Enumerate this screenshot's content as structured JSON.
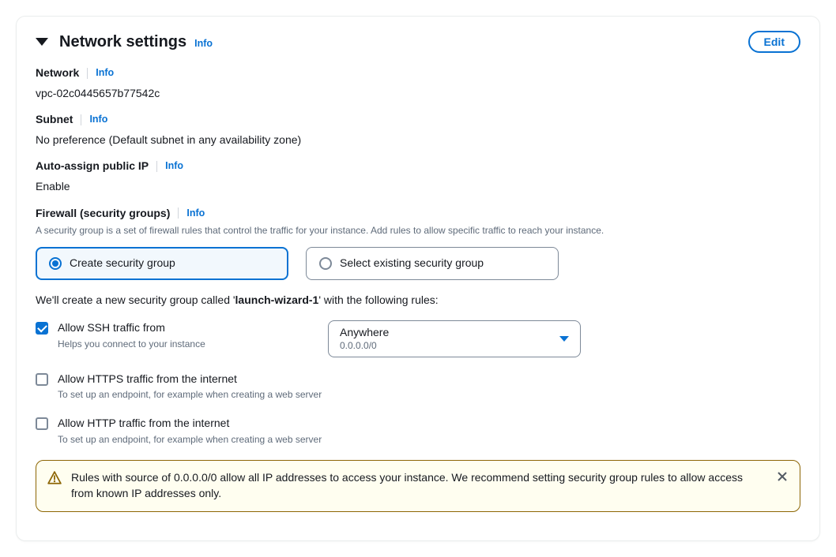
{
  "header": {
    "title": "Network settings",
    "info_label": "Info",
    "edit_label": "Edit"
  },
  "network": {
    "label": "Network",
    "info": "Info",
    "value": "vpc-02c0445657b77542c"
  },
  "subnet": {
    "label": "Subnet",
    "info": "Info",
    "value": "No preference (Default subnet in any availability zone)"
  },
  "public_ip": {
    "label": "Auto-assign public IP",
    "info": "Info",
    "value": "Enable"
  },
  "firewall": {
    "label": "Firewall (security groups)",
    "info": "Info",
    "description": "A security group is a set of firewall rules that control the traffic for your instance. Add rules to allow specific traffic to reach your instance.",
    "options": {
      "create": "Create security group",
      "select_existing": "Select existing security group"
    }
  },
  "sg_sentence": {
    "prefix": "We'll create a new security group called '",
    "name": "launch-wizard-1",
    "suffix": "' with the following rules:"
  },
  "rules": {
    "ssh": {
      "label": "Allow SSH traffic from",
      "desc": "Helps you connect to your instance",
      "select_main": "Anywhere",
      "select_sub": "0.0.0.0/0"
    },
    "https": {
      "label": "Allow HTTPS traffic from the internet",
      "desc": "To set up an endpoint, for example when creating a web server"
    },
    "http": {
      "label": "Allow HTTP traffic from the internet",
      "desc": "To set up an endpoint, for example when creating a web server"
    }
  },
  "warning": {
    "text": "Rules with source of 0.0.0.0/0 allow all IP addresses to access your instance. We recommend setting security group rules to allow access from known IP addresses only."
  }
}
